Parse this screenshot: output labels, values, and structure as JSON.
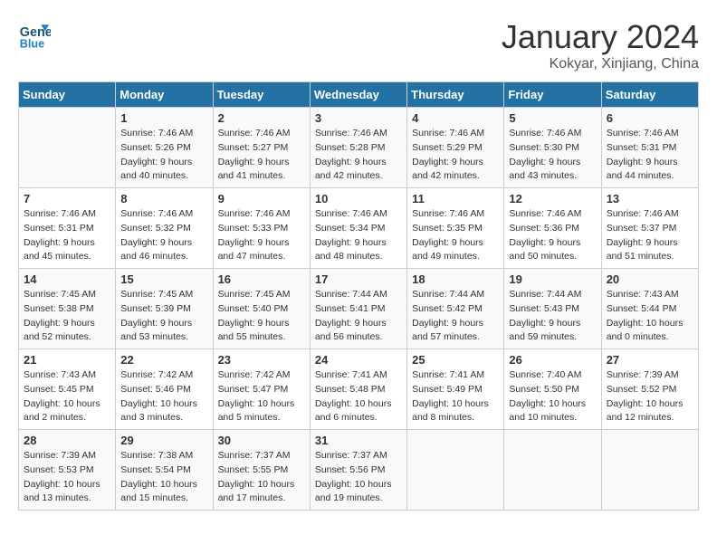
{
  "header": {
    "logo_line1": "General",
    "logo_line2": "Blue",
    "month_title": "January 2024",
    "subtitle": "Kokyar, Xinjiang, China"
  },
  "days_of_week": [
    "Sunday",
    "Monday",
    "Tuesday",
    "Wednesday",
    "Thursday",
    "Friday",
    "Saturday"
  ],
  "weeks": [
    [
      {
        "day": "",
        "info": ""
      },
      {
        "day": "1",
        "info": "Sunrise: 7:46 AM\nSunset: 5:26 PM\nDaylight: 9 hours\nand 40 minutes."
      },
      {
        "day": "2",
        "info": "Sunrise: 7:46 AM\nSunset: 5:27 PM\nDaylight: 9 hours\nand 41 minutes."
      },
      {
        "day": "3",
        "info": "Sunrise: 7:46 AM\nSunset: 5:28 PM\nDaylight: 9 hours\nand 42 minutes."
      },
      {
        "day": "4",
        "info": "Sunrise: 7:46 AM\nSunset: 5:29 PM\nDaylight: 9 hours\nand 42 minutes."
      },
      {
        "day": "5",
        "info": "Sunrise: 7:46 AM\nSunset: 5:30 PM\nDaylight: 9 hours\nand 43 minutes."
      },
      {
        "day": "6",
        "info": "Sunrise: 7:46 AM\nSunset: 5:31 PM\nDaylight: 9 hours\nand 44 minutes."
      }
    ],
    [
      {
        "day": "7",
        "info": "Sunrise: 7:46 AM\nSunset: 5:31 PM\nDaylight: 9 hours\nand 45 minutes."
      },
      {
        "day": "8",
        "info": "Sunrise: 7:46 AM\nSunset: 5:32 PM\nDaylight: 9 hours\nand 46 minutes."
      },
      {
        "day": "9",
        "info": "Sunrise: 7:46 AM\nSunset: 5:33 PM\nDaylight: 9 hours\nand 47 minutes."
      },
      {
        "day": "10",
        "info": "Sunrise: 7:46 AM\nSunset: 5:34 PM\nDaylight: 9 hours\nand 48 minutes."
      },
      {
        "day": "11",
        "info": "Sunrise: 7:46 AM\nSunset: 5:35 PM\nDaylight: 9 hours\nand 49 minutes."
      },
      {
        "day": "12",
        "info": "Sunrise: 7:46 AM\nSunset: 5:36 PM\nDaylight: 9 hours\nand 50 minutes."
      },
      {
        "day": "13",
        "info": "Sunrise: 7:46 AM\nSunset: 5:37 PM\nDaylight: 9 hours\nand 51 minutes."
      }
    ],
    [
      {
        "day": "14",
        "info": "Sunrise: 7:45 AM\nSunset: 5:38 PM\nDaylight: 9 hours\nand 52 minutes."
      },
      {
        "day": "15",
        "info": "Sunrise: 7:45 AM\nSunset: 5:39 PM\nDaylight: 9 hours\nand 53 minutes."
      },
      {
        "day": "16",
        "info": "Sunrise: 7:45 AM\nSunset: 5:40 PM\nDaylight: 9 hours\nand 55 minutes."
      },
      {
        "day": "17",
        "info": "Sunrise: 7:44 AM\nSunset: 5:41 PM\nDaylight: 9 hours\nand 56 minutes."
      },
      {
        "day": "18",
        "info": "Sunrise: 7:44 AM\nSunset: 5:42 PM\nDaylight: 9 hours\nand 57 minutes."
      },
      {
        "day": "19",
        "info": "Sunrise: 7:44 AM\nSunset: 5:43 PM\nDaylight: 9 hours\nand 59 minutes."
      },
      {
        "day": "20",
        "info": "Sunrise: 7:43 AM\nSunset: 5:44 PM\nDaylight: 10 hours\nand 0 minutes."
      }
    ],
    [
      {
        "day": "21",
        "info": "Sunrise: 7:43 AM\nSunset: 5:45 PM\nDaylight: 10 hours\nand 2 minutes."
      },
      {
        "day": "22",
        "info": "Sunrise: 7:42 AM\nSunset: 5:46 PM\nDaylight: 10 hours\nand 3 minutes."
      },
      {
        "day": "23",
        "info": "Sunrise: 7:42 AM\nSunset: 5:47 PM\nDaylight: 10 hours\nand 5 minutes."
      },
      {
        "day": "24",
        "info": "Sunrise: 7:41 AM\nSunset: 5:48 PM\nDaylight: 10 hours\nand 6 minutes."
      },
      {
        "day": "25",
        "info": "Sunrise: 7:41 AM\nSunset: 5:49 PM\nDaylight: 10 hours\nand 8 minutes."
      },
      {
        "day": "26",
        "info": "Sunrise: 7:40 AM\nSunset: 5:50 PM\nDaylight: 10 hours\nand 10 minutes."
      },
      {
        "day": "27",
        "info": "Sunrise: 7:39 AM\nSunset: 5:52 PM\nDaylight: 10 hours\nand 12 minutes."
      }
    ],
    [
      {
        "day": "28",
        "info": "Sunrise: 7:39 AM\nSunset: 5:53 PM\nDaylight: 10 hours\nand 13 minutes."
      },
      {
        "day": "29",
        "info": "Sunrise: 7:38 AM\nSunset: 5:54 PM\nDaylight: 10 hours\nand 15 minutes."
      },
      {
        "day": "30",
        "info": "Sunrise: 7:37 AM\nSunset: 5:55 PM\nDaylight: 10 hours\nand 17 minutes."
      },
      {
        "day": "31",
        "info": "Sunrise: 7:37 AM\nSunset: 5:56 PM\nDaylight: 10 hours\nand 19 minutes."
      },
      {
        "day": "",
        "info": ""
      },
      {
        "day": "",
        "info": ""
      },
      {
        "day": "",
        "info": ""
      }
    ]
  ]
}
